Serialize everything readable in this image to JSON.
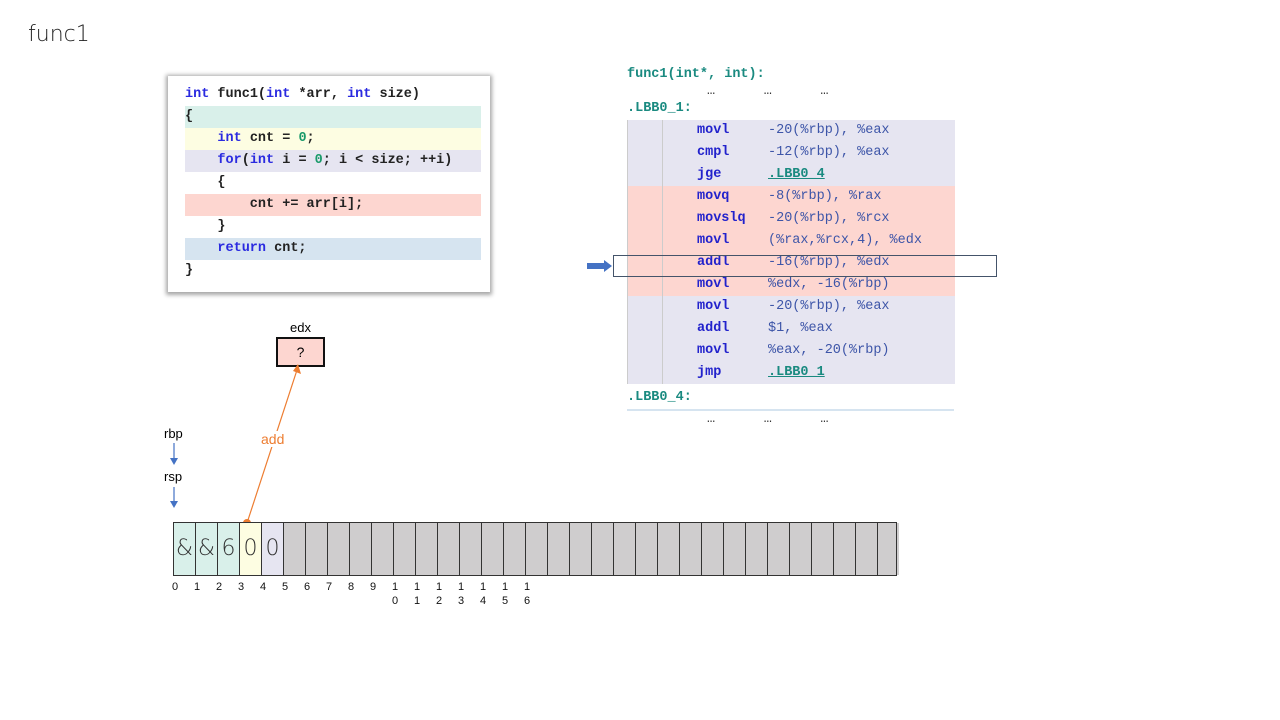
{
  "title": "func1",
  "source": {
    "lines": [
      {
        "html": "<span class='kw'>int</span> func1(<span class='kw'>int</span> *arr, <span class='kw'>int</span> size)",
        "bg": "#ffffff"
      },
      {
        "html": "{",
        "bg": "#d9f0ea"
      },
      {
        "html": "    <span class='kw'>int</span> cnt = <span class='num'>0</span>;",
        "bg": "#fdfde2"
      },
      {
        "html": "    <span class='kw'>for</span>(<span class='kw'>int</span> i = <span class='num'>0</span>; i &lt; size; ++i)",
        "bg": "#e6e5f1"
      },
      {
        "html": "    {",
        "bg": "#ffffff"
      },
      {
        "html": "        cnt += arr[i];",
        "bg": "#fdd6d0"
      },
      {
        "html": "    }",
        "bg": "#ffffff"
      },
      {
        "html": "    <span class='kw'>return</span> cnt;",
        "bg": "#d6e4f0"
      },
      {
        "html": "}",
        "bg": "#ffffff"
      }
    ]
  },
  "asm": {
    "header": "func1(int*, int):",
    "ellipsis": "…      …      …",
    "label1": ".LBB0_1:",
    "label2": ".LBB0_4:",
    "rows": [
      {
        "op": "movl",
        "arg": "-20(%rbp), %eax",
        "bg": "#e6e5f1"
      },
      {
        "op": "cmpl",
        "arg": "-12(%rbp), %eax",
        "bg": "#e6e5f1"
      },
      {
        "op": "jge",
        "arg": ".LBB0_4",
        "bg": "#e6e5f1",
        "link": true
      },
      {
        "op": "movq",
        "arg": "-8(%rbp), %rax",
        "bg": "#fdd6d0"
      },
      {
        "op": "movslq",
        "arg": "-20(%rbp), %rcx",
        "bg": "#fdd6d0"
      },
      {
        "op": "movl",
        "arg": "(%rax,%rcx,4), %edx",
        "bg": "#fdd6d0"
      },
      {
        "op": "addl",
        "arg": "-16(%rbp), %edx",
        "bg": "#fdd6d0",
        "current": true
      },
      {
        "op": "movl",
        "arg": "%edx, -16(%rbp)",
        "bg": "#fdd6d0"
      },
      {
        "op": "movl",
        "arg": "-20(%rbp), %eax",
        "bg": "#e6e5f1"
      },
      {
        "op": "addl",
        "arg": "$1, %eax",
        "bg": "#e6e5f1"
      },
      {
        "op": "movl",
        "arg": "%eax, -20(%rbp)",
        "bg": "#e6e5f1"
      },
      {
        "op": "jmp",
        "arg": ".LBB0_1",
        "bg": "#e6e5f1",
        "link": true
      }
    ]
  },
  "register": {
    "name": "edx",
    "value": "?"
  },
  "arrow_label": "add",
  "pointers": {
    "rbp": "rbp",
    "rsp": "rsp"
  },
  "memory": {
    "cells": [
      "&",
      "&",
      "6",
      "0",
      "0",
      "",
      "",
      "",
      "",
      "",
      "",
      "",
      "",
      "",
      "",
      "",
      "",
      "",
      "",
      "",
      "",
      "",
      "",
      "",
      "",
      "",
      "",
      "",
      "",
      "",
      "",
      "",
      ""
    ],
    "colors": [
      "#d9f0ea",
      "#d9f0ea",
      "#d9f0ea",
      "#fdfde2",
      "#e6e5f1"
    ],
    "indices": [
      "0",
      "1",
      "2",
      "3",
      "4",
      "5",
      "6",
      "7",
      "8",
      "9",
      "1\n0",
      "1\n1",
      "1\n2",
      "1\n3",
      "1\n4",
      "1\n5",
      "1\n6"
    ]
  }
}
